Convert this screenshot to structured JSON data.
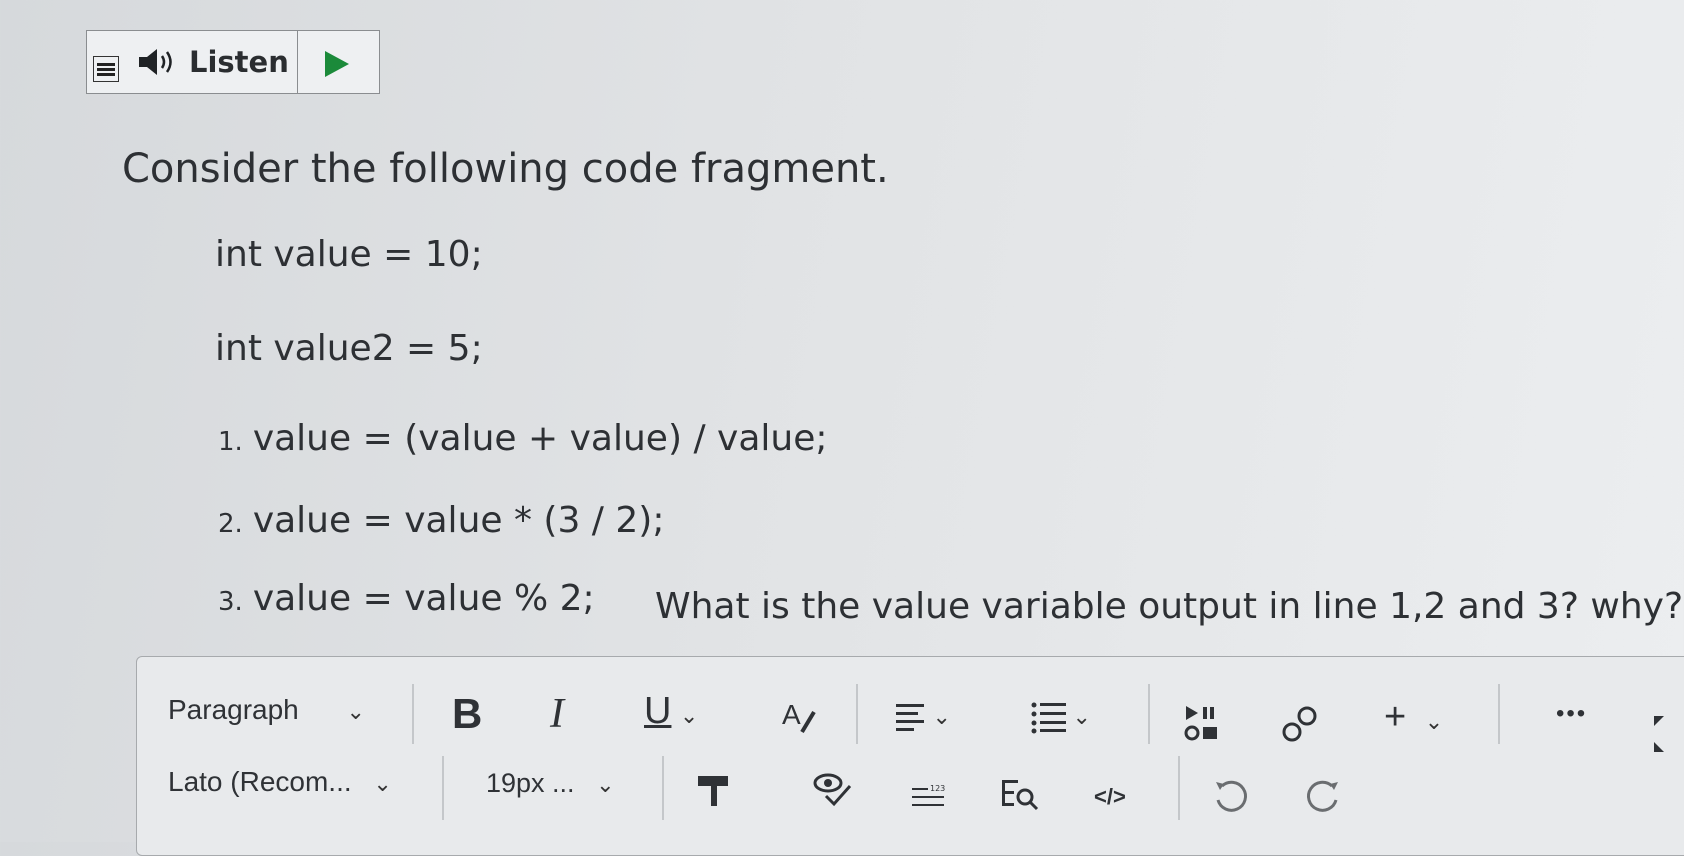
{
  "listen": {
    "label": "Listen"
  },
  "question": {
    "intro": "Consider the following code fragment.",
    "decl1": "int value = 10;",
    "decl2": "int value2 = 5;",
    "lines": [
      {
        "num": "1.",
        "text": "value = (value + value) / value;"
      },
      {
        "num": "2.",
        "text": "value = value * (3 / 2);"
      },
      {
        "num": "3.",
        "text": "value = value % 2;"
      }
    ],
    "ask": "What is the value variable output in line 1,2 and 3? why?"
  },
  "toolbar": {
    "block_format": "Paragraph",
    "font_family": "Lato (Recom...",
    "font_size": "19px ...",
    "more": "•••"
  }
}
